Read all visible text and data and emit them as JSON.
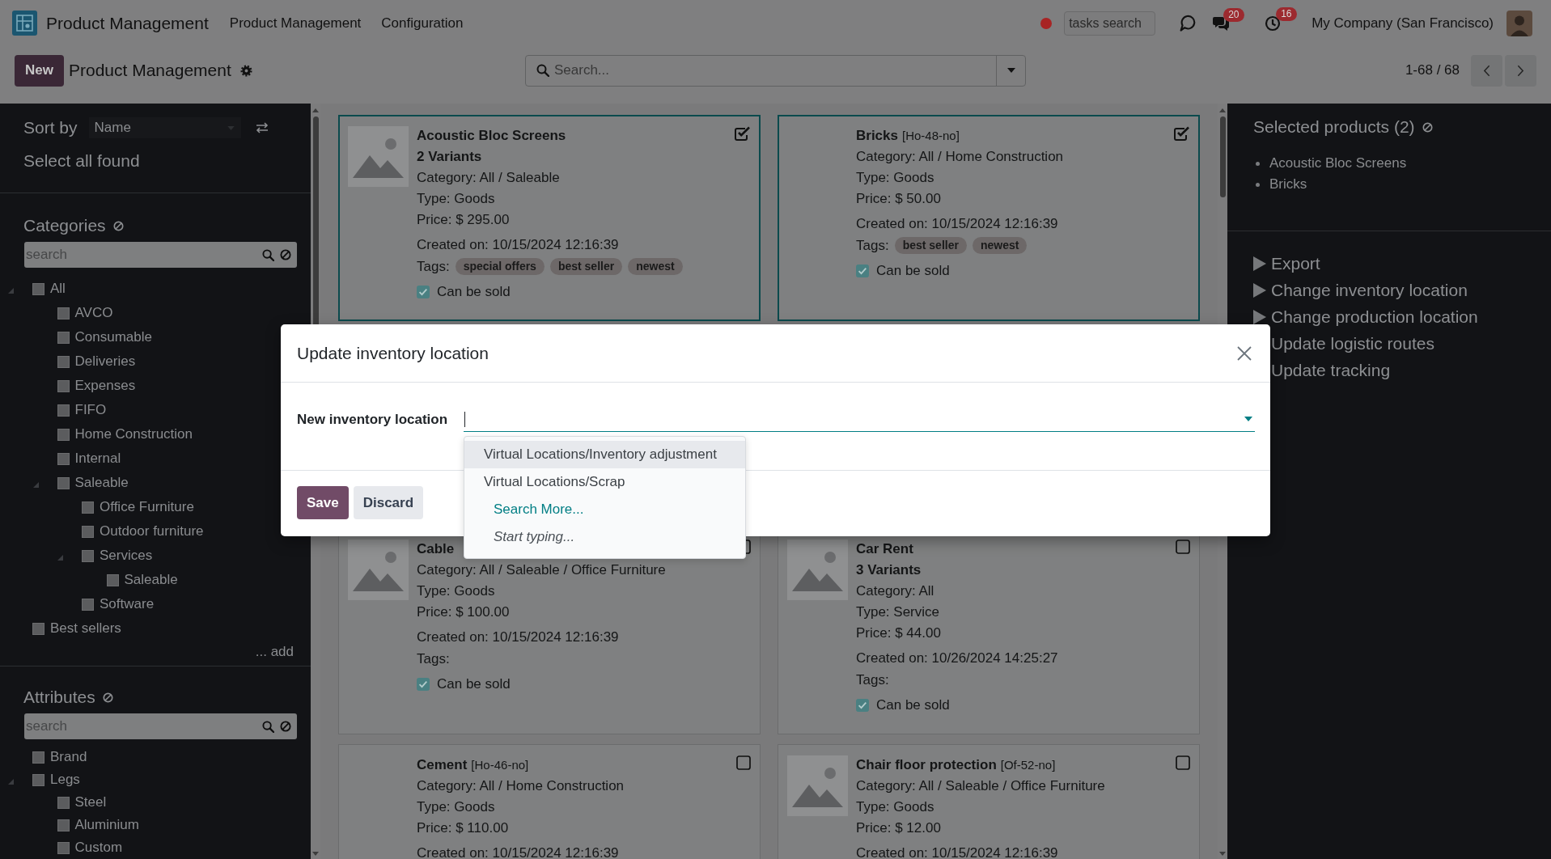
{
  "navbar": {
    "app_name": "Product Management",
    "menu": [
      "Product Management",
      "Configuration"
    ],
    "tasks_search": {
      "placeholder": "tasks search"
    },
    "messages_badge": "20",
    "activities_badge": "16",
    "company": "My Company (San Francisco)"
  },
  "control_panel": {
    "new_button": "New",
    "breadcrumb": "Product Management",
    "search": {
      "placeholder": "Search..."
    },
    "pager": "1-68 / 68"
  },
  "sidebar": {
    "sort": {
      "label": "Sort by",
      "value": "Name"
    },
    "select_all": "Select all found",
    "sections": [
      {
        "title": "Categories",
        "search": {
          "placeholder": "search"
        },
        "tree": [
          {
            "label": "All",
            "checked": false,
            "children": [
              {
                "label": "AVCO",
                "checked": false
              },
              {
                "label": "Consumable",
                "checked": false
              },
              {
                "label": "Deliveries",
                "checked": false
              },
              {
                "label": "Expenses",
                "checked": false
              },
              {
                "label": "FIFO",
                "checked": false
              },
              {
                "label": "Home Construction",
                "checked": false
              },
              {
                "label": "Internal",
                "checked": false
              },
              {
                "label": "Saleable",
                "checked": false,
                "children": [
                  {
                    "label": "Office Furniture",
                    "checked": false
                  },
                  {
                    "label": "Outdoor furniture",
                    "checked": false
                  },
                  {
                    "label": "Services",
                    "checked": false,
                    "children": [
                      {
                        "label": "Saleable",
                        "checked": false
                      }
                    ]
                  },
                  {
                    "label": "Software",
                    "checked": false
                  }
                ]
              }
            ]
          },
          {
            "label": "Best sellers",
            "checked": false
          }
        ],
        "add_link": "... add"
      },
      {
        "title": "Attributes",
        "search": {
          "placeholder": "search"
        },
        "tree": [
          {
            "label": "Brand",
            "checked": false
          },
          {
            "label": "Legs",
            "checked": false,
            "children": [
              {
                "label": "Steel",
                "checked": false
              },
              {
                "label": "Aluminium",
                "checked": false
              },
              {
                "label": "Custom",
                "checked": false
              }
            ]
          }
        ]
      }
    ]
  },
  "products": [
    {
      "selected": true,
      "name": "Acoustic Bloc Screens",
      "variants": "2 Variants",
      "photo": true,
      "lines": [
        "Category: All / Saleable",
        "Type: Goods",
        "Price: $ 295.00"
      ],
      "created": "Created on: 10/15/2024 12:16:39",
      "tags": {
        "label": "Tags:",
        "items": [
          "special offers",
          "best seller",
          "newest"
        ]
      },
      "can_be_sold": {
        "label": "Can be sold",
        "checked": true
      }
    },
    {
      "selected": true,
      "name": "Bricks",
      "code": "[Ho-48-no]",
      "photo": false,
      "lines": [
        "Category: All / Home Construction",
        "Type: Goods",
        "Price: $ 50.00"
      ],
      "created": "Created on: 10/15/2024 12:16:39",
      "tags": {
        "label": "Tags:",
        "items": [
          "best seller",
          "newest"
        ]
      },
      "can_be_sold": {
        "label": "Can be sold",
        "checked": true
      }
    },
    {
      "selected": false,
      "name": "Cable",
      "photo": true,
      "lines": [
        "Category: All / Saleable / Office Furniture",
        "Type: Goods",
        "Price: $ 100.00"
      ],
      "created": "Created on: 10/15/2024 12:16:39",
      "tags": {
        "label": "Tags:"
      },
      "can_be_sold": {
        "label": "Can be sold",
        "checked": true
      }
    },
    {
      "selected": false,
      "name": "Car Rent",
      "variants": "3 Variants",
      "photo": true,
      "lines": [
        "Category: All",
        "Type: Service",
        "Price: $ 44.00"
      ],
      "created": "Created on: 10/26/2024 14:25:27",
      "tags": {
        "label": "Tags:"
      },
      "can_be_sold": {
        "label": "Can be sold",
        "checked": true
      }
    },
    {
      "selected": false,
      "name": "Cement",
      "code": "[Ho-46-no]",
      "photo": false,
      "lines": [
        "Category: All / Home Construction",
        "Type: Goods",
        "Price: $ 110.00"
      ],
      "created": "Created on: 10/15/2024 12:16:39"
    },
    {
      "selected": false,
      "name": "Chair floor protection",
      "code": "[Of-52-no]",
      "photo": true,
      "lines": [
        "Category: All / Saleable / Office Furniture",
        "Type: Goods",
        "Price: $ 12.00"
      ],
      "created": "Created on: 10/15/2024 12:16:39"
    }
  ],
  "selection_panel": {
    "title": "Selected products (2)",
    "items": [
      "Acoustic Bloc Screens",
      "Bricks"
    ],
    "actions": [
      {
        "label": "Export",
        "expander": true
      },
      {
        "label": "Change inventory location",
        "expander": true
      },
      {
        "label": "Change production location",
        "expander": true
      },
      {
        "label": "Update logistic routes",
        "expander": false
      },
      {
        "label": "Update tracking",
        "expander": false
      }
    ]
  },
  "dialog": {
    "title": "Update inventory location",
    "field": {
      "label": "New inventory location",
      "focused": true
    },
    "options": [
      {
        "label": "Virtual Locations/Inventory adjustment",
        "kind": "option",
        "selected": true
      },
      {
        "label": "Virtual Locations/Scrap",
        "kind": "option",
        "selected": false
      },
      {
        "label": "Search More...",
        "kind": "link",
        "selected": false
      },
      {
        "label": "Start typing...",
        "kind": "hint",
        "selected": false
      }
    ],
    "buttons": [
      {
        "label": "Save",
        "kind": "primary"
      },
      {
        "label": "Discard",
        "kind": "secondary"
      }
    ]
  }
}
